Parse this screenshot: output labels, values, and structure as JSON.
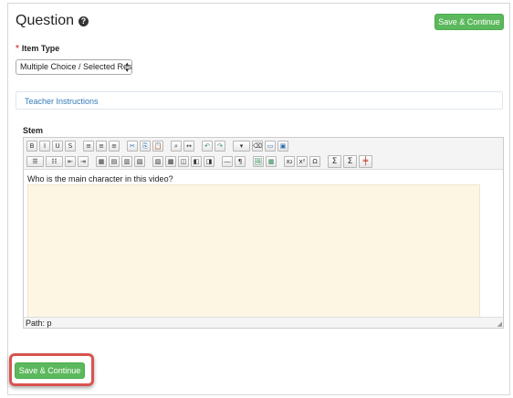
{
  "header": {
    "title": "Question",
    "help_icon": "?",
    "save_top_label": "Save & Continue"
  },
  "item_type": {
    "required_marker": "*",
    "label": "Item Type",
    "selected": "Multiple Choice / Selected Res|"
  },
  "teacher_instructions": {
    "label": "Teacher Instructions"
  },
  "stem": {
    "label": "Stem",
    "text": "Who is the main character in this video?",
    "path": "Path: p"
  },
  "footer": {
    "save_bottom_label": "Save & Continue"
  },
  "colors": {
    "accent_green": "#5cb85c",
    "link_blue": "#337ab7",
    "highlight_red": "#d9534f",
    "answer_bg": "#fdf6e3"
  },
  "toolbar_row1": [
    {
      "name": "bold-button",
      "glyph": "B"
    },
    {
      "name": "italic-button",
      "glyph": "I"
    },
    {
      "name": "underline-button",
      "glyph": "U"
    },
    {
      "name": "strikethrough-button",
      "glyph": "S"
    },
    {
      "name": "align-left-button",
      "glyph": "≡"
    },
    {
      "name": "align-center-button",
      "glyph": "≡"
    },
    {
      "name": "align-right-button",
      "glyph": "≡"
    },
    {
      "name": "cut-button",
      "glyph": "✂"
    },
    {
      "name": "copy-button",
      "glyph": "⎘"
    },
    {
      "name": "paste-button",
      "glyph": "📋"
    },
    {
      "name": "find-button",
      "glyph": "⌕"
    },
    {
      "name": "replace-button",
      "glyph": "↔"
    },
    {
      "name": "undo-button",
      "glyph": "↶"
    },
    {
      "name": "redo-button",
      "glyph": "↷"
    },
    {
      "name": "style-dropdown-button",
      "glyph": "▾"
    },
    {
      "name": "eraser-button",
      "glyph": "⌫"
    },
    {
      "name": "image-button",
      "glyph": "▭"
    },
    {
      "name": "media-button",
      "glyph": "▣"
    }
  ],
  "toolbar_row2": [
    {
      "name": "bullet-list-button",
      "glyph": "☰"
    },
    {
      "name": "numbered-list-button",
      "glyph": "☷"
    },
    {
      "name": "outdent-button",
      "glyph": "⇤"
    },
    {
      "name": "indent-button",
      "glyph": "⇥"
    },
    {
      "name": "table-button",
      "glyph": "▦"
    },
    {
      "name": "table-row-button",
      "glyph": "▤"
    },
    {
      "name": "table-col-button",
      "glyph": "▥"
    },
    {
      "name": "table-delete-button",
      "glyph": "▧"
    },
    {
      "name": "cell-merge-button",
      "glyph": "▨"
    },
    {
      "name": "cell-split-button",
      "glyph": "▩"
    },
    {
      "name": "cell-props-button",
      "glyph": "◫"
    },
    {
      "name": "row-props-button",
      "glyph": "◧"
    },
    {
      "name": "col-props-button",
      "glyph": "◨"
    },
    {
      "name": "hr-button",
      "glyph": "―"
    },
    {
      "name": "special-button",
      "glyph": "¶"
    },
    {
      "name": "insert-image-button",
      "glyph": "🖼"
    },
    {
      "name": "spreadsheet-button",
      "glyph": "▦"
    },
    {
      "name": "subscript-button",
      "glyph": "x₂"
    },
    {
      "name": "superscript-button",
      "glyph": "x²"
    },
    {
      "name": "omega-button",
      "glyph": "Ω"
    },
    {
      "name": "sigma-box-button",
      "glyph": "Σ"
    },
    {
      "name": "sigma-button",
      "glyph": "Σ"
    },
    {
      "name": "graph-button",
      "glyph": "╪"
    }
  ]
}
